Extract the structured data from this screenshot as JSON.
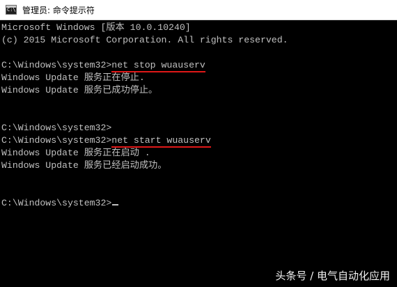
{
  "window": {
    "icon_label": "C:\\",
    "title": "管理员: 命令提示符"
  },
  "console": {
    "lines": [
      {
        "text": "Microsoft Windows [版本 10.0.10240]"
      },
      {
        "text": "(c) 2015 Microsoft Corporation. All rights reserved."
      },
      {
        "text": ""
      },
      {
        "prompt": "C:\\Windows\\system32>",
        "command": "net stop wuauserv"
      },
      {
        "text": "Windows Update 服务正在停止."
      },
      {
        "text": "Windows Update 服务已成功停止。"
      },
      {
        "text": ""
      },
      {
        "text": ""
      },
      {
        "text": "C:\\Windows\\system32>"
      },
      {
        "prompt": "C:\\Windows\\system32>",
        "command": "net start wuauserv"
      },
      {
        "text": "Windows Update 服务正在启动 ."
      },
      {
        "text": "Windows Update 服务已经启动成功。"
      },
      {
        "text": ""
      },
      {
        "text": ""
      },
      {
        "prompt": "C:\\Windows\\system32>"
      }
    ]
  },
  "watermark": "头条号 / 电气自动化应用",
  "colors": {
    "background": "#000000",
    "text": "#c0c0c0",
    "underline": "#e01818"
  }
}
